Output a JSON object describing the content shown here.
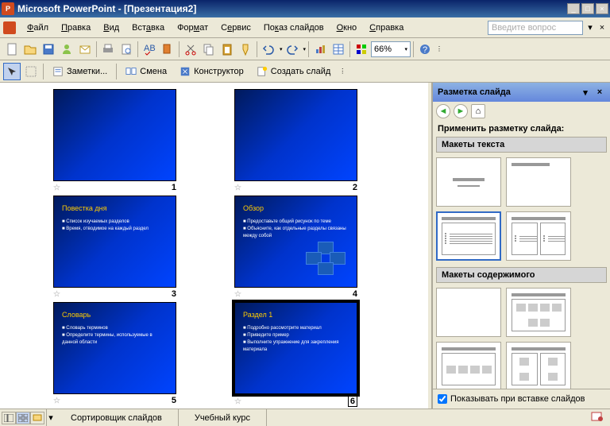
{
  "window": {
    "title": "Microsoft PowerPoint - [Презентация2]"
  },
  "menubar": {
    "file": "Файл",
    "edit": "Правка",
    "view": "Вид",
    "insert": "Вставка",
    "format": "Формат",
    "tools": "Сервис",
    "slideshow": "Показ слайдов",
    "window": "Окно",
    "help": "Справка",
    "question_placeholder": "Введите вопрос"
  },
  "toolbar": {
    "zoom": "66%"
  },
  "toolbar2": {
    "notes": "Заметки...",
    "shift": "Смена",
    "designer": "Конструктор",
    "new_slide": "Создать слайд"
  },
  "slides": [
    {
      "num": "1",
      "title": "",
      "body": ""
    },
    {
      "num": "2",
      "title": "",
      "body": ""
    },
    {
      "num": "3",
      "title": "Повестка дня",
      "body": "■ Список изучаемых разделов\n■ Время, отводимое на каждый раздел"
    },
    {
      "num": "4",
      "title": "Обзор",
      "body": "■ Предоставьте общий рисунок по теме\n■ Объясните, как отдельные разделы связаны между собой"
    },
    {
      "num": "5",
      "title": "Словарь",
      "body": "■ Словарь терминов\n■ Определите термины, используемые в данной области"
    },
    {
      "num": "6",
      "title": "Раздел 1",
      "body": "■ Подробно рассмотрите материал\n■ Приведите пример\n■ Выполните упражнение для закрепления материала"
    }
  ],
  "taskpane": {
    "title": "Разметка слайда",
    "apply_label": "Применить разметку слайда:",
    "section_text": "Макеты текста",
    "section_content": "Макеты содержимого",
    "footer_checkbox": "Показывать при вставке слайдов"
  },
  "status": {
    "sorter": "Сортировщик слайдов",
    "course": "Учебный курс"
  }
}
